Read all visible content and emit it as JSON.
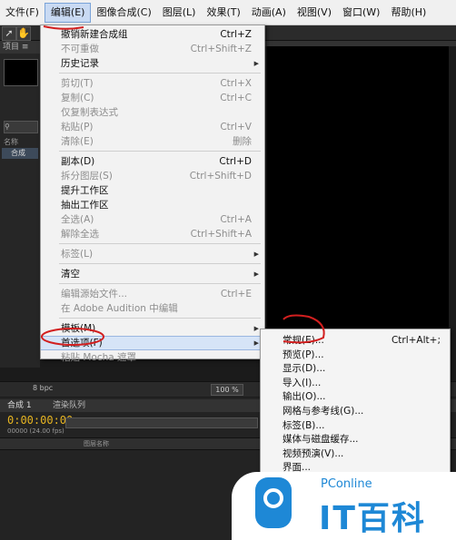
{
  "menubar": [
    {
      "label": "文件(F)"
    },
    {
      "label": "编辑(E)",
      "active": true
    },
    {
      "label": "图像合成(C)"
    },
    {
      "label": "图层(L)"
    },
    {
      "label": "效果(T)"
    },
    {
      "label": "动画(A)"
    },
    {
      "label": "视图(V)"
    },
    {
      "label": "窗口(W)"
    },
    {
      "label": "帮助(H)"
    }
  ],
  "panel_tab_project": "项目 ≡",
  "panel_label_name": "名称",
  "panel_item_comp": "合成",
  "edit_menu": [
    {
      "label": "撤销新建合成组",
      "shortcut": "Ctrl+Z",
      "disabled": false
    },
    {
      "label": "不可重做",
      "shortcut": "Ctrl+Shift+Z",
      "disabled": true
    },
    {
      "label": "历史记录",
      "submenu": true,
      "disabled": false
    },
    {
      "sep": true
    },
    {
      "label": "剪切(T)",
      "shortcut": "Ctrl+X",
      "disabled": true
    },
    {
      "label": "复制(C)",
      "shortcut": "Ctrl+C",
      "disabled": true
    },
    {
      "label": "仅复制表达式",
      "disabled": true
    },
    {
      "label": "粘贴(P)",
      "shortcut": "Ctrl+V",
      "disabled": true
    },
    {
      "label": "清除(E)",
      "shortcut": "删除",
      "disabled": true
    },
    {
      "sep": true
    },
    {
      "label": "副本(D)",
      "shortcut": "Ctrl+D",
      "disabled": false
    },
    {
      "label": "拆分图层(S)",
      "shortcut": "Ctrl+Shift+D",
      "disabled": true
    },
    {
      "label": "提升工作区",
      "disabled": false
    },
    {
      "label": "抽出工作区",
      "disabled": false
    },
    {
      "label": "全选(A)",
      "shortcut": "Ctrl+A",
      "disabled": true
    },
    {
      "label": "解除全选",
      "shortcut": "Ctrl+Shift+A",
      "disabled": true
    },
    {
      "sep": true
    },
    {
      "label": "标签(L)",
      "submenu": true,
      "disabled": true
    },
    {
      "sep": true
    },
    {
      "label": "清空",
      "submenu": true,
      "disabled": false
    },
    {
      "sep": true
    },
    {
      "label": "编辑源始文件...",
      "shortcut": "Ctrl+E",
      "disabled": true
    },
    {
      "label": "在 Adobe Audition 中编辑",
      "disabled": true
    },
    {
      "sep": true
    },
    {
      "label": "模板(M)",
      "submenu": true,
      "disabled": false
    },
    {
      "label": "首选项(F)",
      "submenu": true,
      "disabled": false,
      "highlight": true
    },
    {
      "label": "粘贴 Mocha 遮罩",
      "disabled": true
    }
  ],
  "prefs_submenu": [
    {
      "label": "常规(E)...",
      "shortcut": "Ctrl+Alt+;"
    },
    {
      "label": "预览(P)..."
    },
    {
      "label": "显示(D)..."
    },
    {
      "label": "导入(I)..."
    },
    {
      "label": "输出(O)..."
    },
    {
      "label": "网格与参考线(G)..."
    },
    {
      "label": "标签(B)..."
    },
    {
      "label": "媒体与磁盘缓存..."
    },
    {
      "label": "视频预演(V)..."
    },
    {
      "label": "界面..."
    }
  ],
  "viewer_zoom": "100 %",
  "bpc_label": "8 bpc",
  "timeline": {
    "tab_comp": "合成 1",
    "tab_render": "渲染队列",
    "timecode": "0:00:00:00",
    "fps": "00000 (24.00 fps)",
    "layer_name_col": "图层名称"
  },
  "watermark": {
    "brand": "PConline",
    "title": "IT百科"
  },
  "colors": {
    "menu_bg": "#f2f2f2",
    "highlight": "#d6e4f7",
    "annotation": "#d21f1f",
    "timecode": "#e6b422",
    "logo_blue": "#1e88d6"
  }
}
